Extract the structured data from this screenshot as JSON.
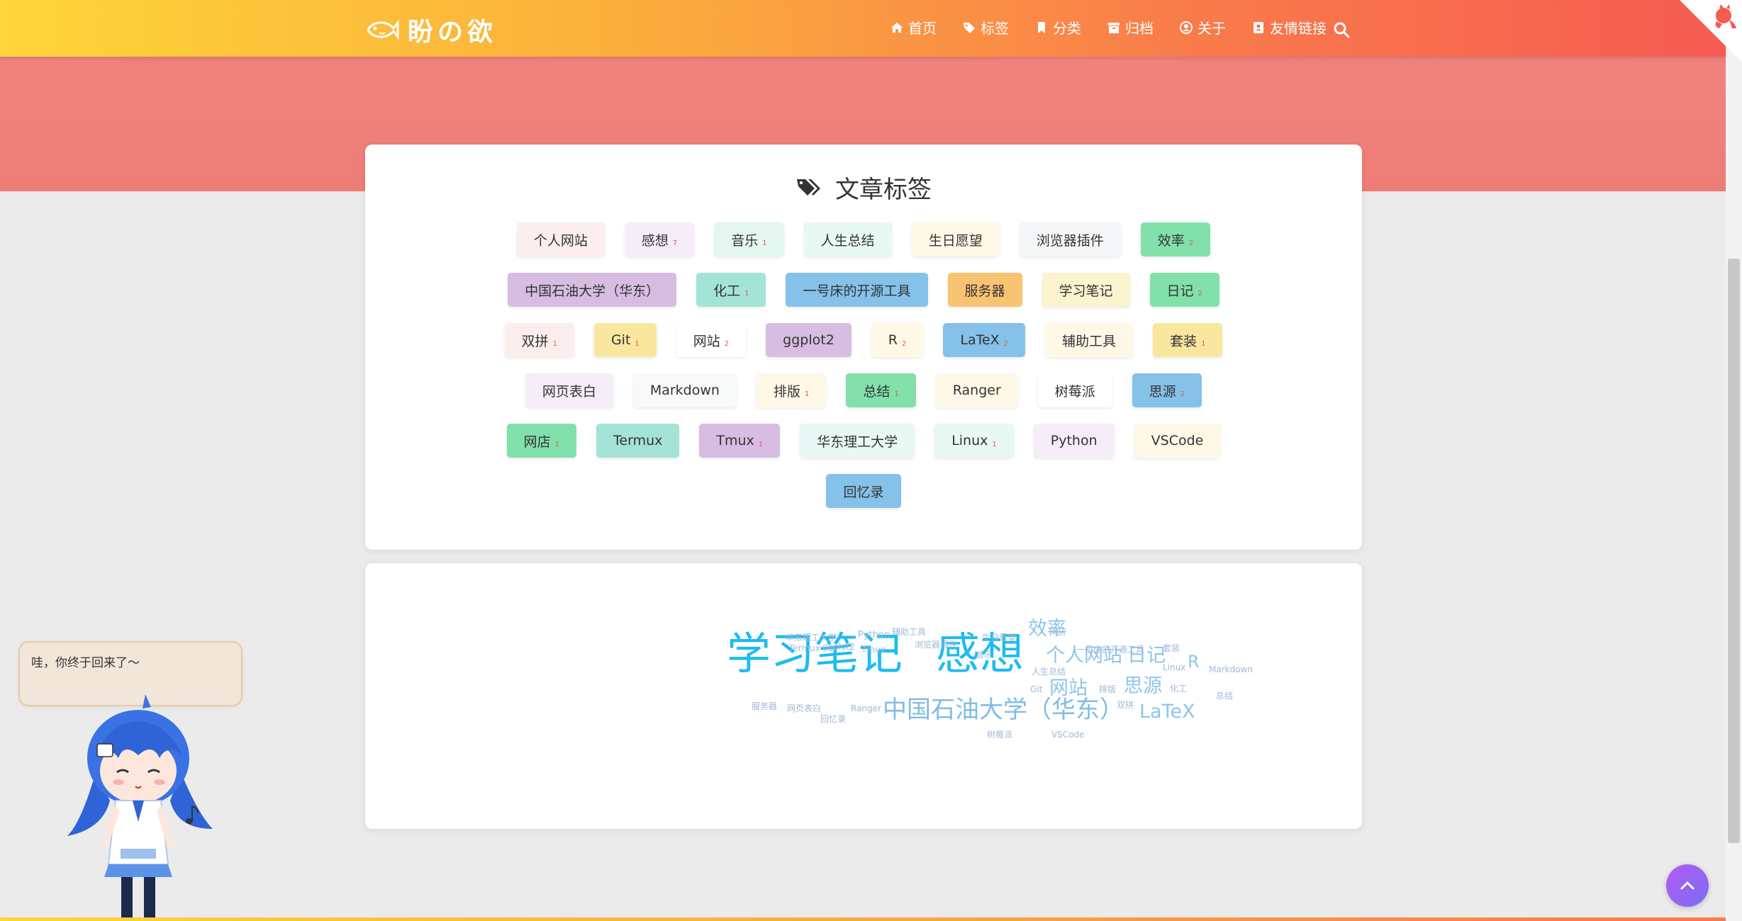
{
  "header": {
    "brand": "盼の欲",
    "nav": [
      {
        "icon": "home-icon",
        "label": "首页"
      },
      {
        "icon": "tag-icon",
        "label": "标签"
      },
      {
        "icon": "bookmark-icon",
        "label": "分类"
      },
      {
        "icon": "archive-icon",
        "label": "归档"
      },
      {
        "icon": "user-circle-icon",
        "label": "关于"
      },
      {
        "icon": "address-book-icon",
        "label": "友情链接"
      }
    ],
    "search_icon": "search-icon"
  },
  "tags_card": {
    "title": "文章标签",
    "tags": [
      {
        "label": "个人网站",
        "count": "",
        "bg": "#fbeeed"
      },
      {
        "label": "感想",
        "count": "7",
        "bg": "#f5eef8"
      },
      {
        "label": "音乐",
        "count": "1",
        "bg": "#e3f7ef"
      },
      {
        "label": "人生总结",
        "count": "",
        "bg": "#e8f8f5"
      },
      {
        "label": "生日愿望",
        "count": "",
        "bg": "#fef8e6"
      },
      {
        "label": "浏览器插件",
        "count": "",
        "bg": "#f4f6f7"
      },
      {
        "label": "效率",
        "count": "2",
        "bg": "#82e0aa"
      },
      {
        "label": "中国石油大学（华东）",
        "count": "",
        "bg": "#d7bde2"
      },
      {
        "label": "化工",
        "count": "1",
        "bg": "#a3e4d7"
      },
      {
        "label": "一号床的开源工具",
        "count": "",
        "bg": "#85c1e9"
      },
      {
        "label": "服务器",
        "count": "",
        "bg": "#f8c471"
      },
      {
        "label": "学习笔记",
        "count": "",
        "bg": "#fcf3cf"
      },
      {
        "label": "日记",
        "count": "2",
        "bg": "#82e0aa"
      },
      {
        "label": "双拼",
        "count": "1",
        "bg": "#fbeeed"
      },
      {
        "label": "Git",
        "count": "1",
        "bg": "#f9e79f"
      },
      {
        "label": "网站",
        "count": "2",
        "bg": "#ffffff"
      },
      {
        "label": "ggplot2",
        "count": "",
        "bg": "#d7bde2"
      },
      {
        "label": "R",
        "count": "2",
        "bg": "#fef9e7"
      },
      {
        "label": "LaTeX",
        "count": "2",
        "bg": "#85c1e9"
      },
      {
        "label": "辅助工具",
        "count": "",
        "bg": "#fef9e7"
      },
      {
        "label": "套装",
        "count": "1",
        "bg": "#f9e79f"
      },
      {
        "label": "网页表白",
        "count": "",
        "bg": "#f5eef8"
      },
      {
        "label": "Markdown",
        "count": "",
        "bg": "#f8f9f9"
      },
      {
        "label": "排版",
        "count": "1",
        "bg": "#fef9e7"
      },
      {
        "label": "总结",
        "count": "1",
        "bg": "#82e0aa"
      },
      {
        "label": "Ranger",
        "count": "",
        "bg": "#fef9e7"
      },
      {
        "label": "树莓派",
        "count": "",
        "bg": "#ffffff"
      },
      {
        "label": "思源",
        "count": "2",
        "bg": "#85c1e9"
      },
      {
        "label": "网店",
        "count": "1",
        "bg": "#82e0aa"
      },
      {
        "label": "Termux",
        "count": "",
        "bg": "#a3e4d7"
      },
      {
        "label": "Tmux",
        "count": "1",
        "bg": "#d7bde2"
      },
      {
        "label": "华东理工大学",
        "count": "",
        "bg": "#e8f8f5"
      },
      {
        "label": "Linux",
        "count": "1",
        "bg": "#e8f8f5"
      },
      {
        "label": "Python",
        "count": "",
        "bg": "#f5eef8"
      },
      {
        "label": "VSCode",
        "count": "",
        "bg": "#fef9e7"
      },
      {
        "label": "回忆录",
        "count": "",
        "bg": "#85c1e9"
      }
    ]
  },
  "word_cloud": {
    "words": [
      {
        "text": "学习笔记",
        "color": "#1dbcf0"
      },
      {
        "text": "感想",
        "color": "#1dbcf0"
      },
      {
        "text": "中国石油大学（华东）",
        "color": "#7fbde6"
      },
      {
        "text": "个人网站",
        "color": "#8cc6ea"
      },
      {
        "text": "日记",
        "color": "#8cc6ea"
      },
      {
        "text": "效率",
        "color": "#8cc6ea"
      },
      {
        "text": "思源",
        "color": "#8cc6ea"
      },
      {
        "text": "网站",
        "color": "#8cc6ea"
      },
      {
        "text": "LaTeX",
        "color": "#8cc6ea"
      },
      {
        "text": "R",
        "color": "#8cc6ea"
      },
      {
        "text": "华东理工大学",
        "color": "#9fb8d8"
      },
      {
        "text": "Python",
        "color": "#9fb8d8"
      },
      {
        "text": "辅助工具",
        "color": "#9fb8d8"
      },
      {
        "text": "网店",
        "color": "#9fb8d8"
      },
      {
        "text": "Termux",
        "color": "#9fb8d8"
      },
      {
        "text": "ggplot2",
        "color": "#9fb8d8"
      },
      {
        "text": "Tmux",
        "color": "#9fb8d8"
      },
      {
        "text": "浏览器插件",
        "color": "#9fb8d8"
      },
      {
        "text": "生日愿望",
        "color": "#9fb8d8"
      },
      {
        "text": "一号床的开源工具",
        "color": "#9fb8d8"
      },
      {
        "text": "套装",
        "color": "#9fb8d8"
      },
      {
        "text": "音乐",
        "color": "#9fb8d8"
      },
      {
        "text": "人生总结",
        "color": "#9fb8d8"
      },
      {
        "text": "Linux",
        "color": "#9fb8d8"
      },
      {
        "text": "Markdown",
        "color": "#9fb8d8"
      },
      {
        "text": "Git",
        "color": "#9fb8d8"
      },
      {
        "text": "排版",
        "color": "#9fb8d8"
      },
      {
        "text": "化工",
        "color": "#9fb8d8"
      },
      {
        "text": "总结",
        "color": "#9fb8d8"
      },
      {
        "text": "服务器",
        "color": "#9fb8d8"
      },
      {
        "text": "网页表白",
        "color": "#9fb8d8"
      },
      {
        "text": "Ranger",
        "color": "#9fb8d8"
      },
      {
        "text": "回忆录",
        "color": "#9fb8d8"
      },
      {
        "text": "双拼",
        "color": "#9fb8d8"
      },
      {
        "text": "树莓派",
        "color": "#9fb8d8"
      },
      {
        "text": "VSCode",
        "color": "#9fb8d8"
      }
    ]
  },
  "mascot": {
    "bubble_text": "哇，你终于回来了～"
  },
  "theme": {
    "header_gradient": [
      "#fed53a",
      "#f65b52"
    ],
    "hero_color": "#ee7d76",
    "back_top_gradient": [
      "#b15cf6",
      "#7c6cf0"
    ]
  }
}
